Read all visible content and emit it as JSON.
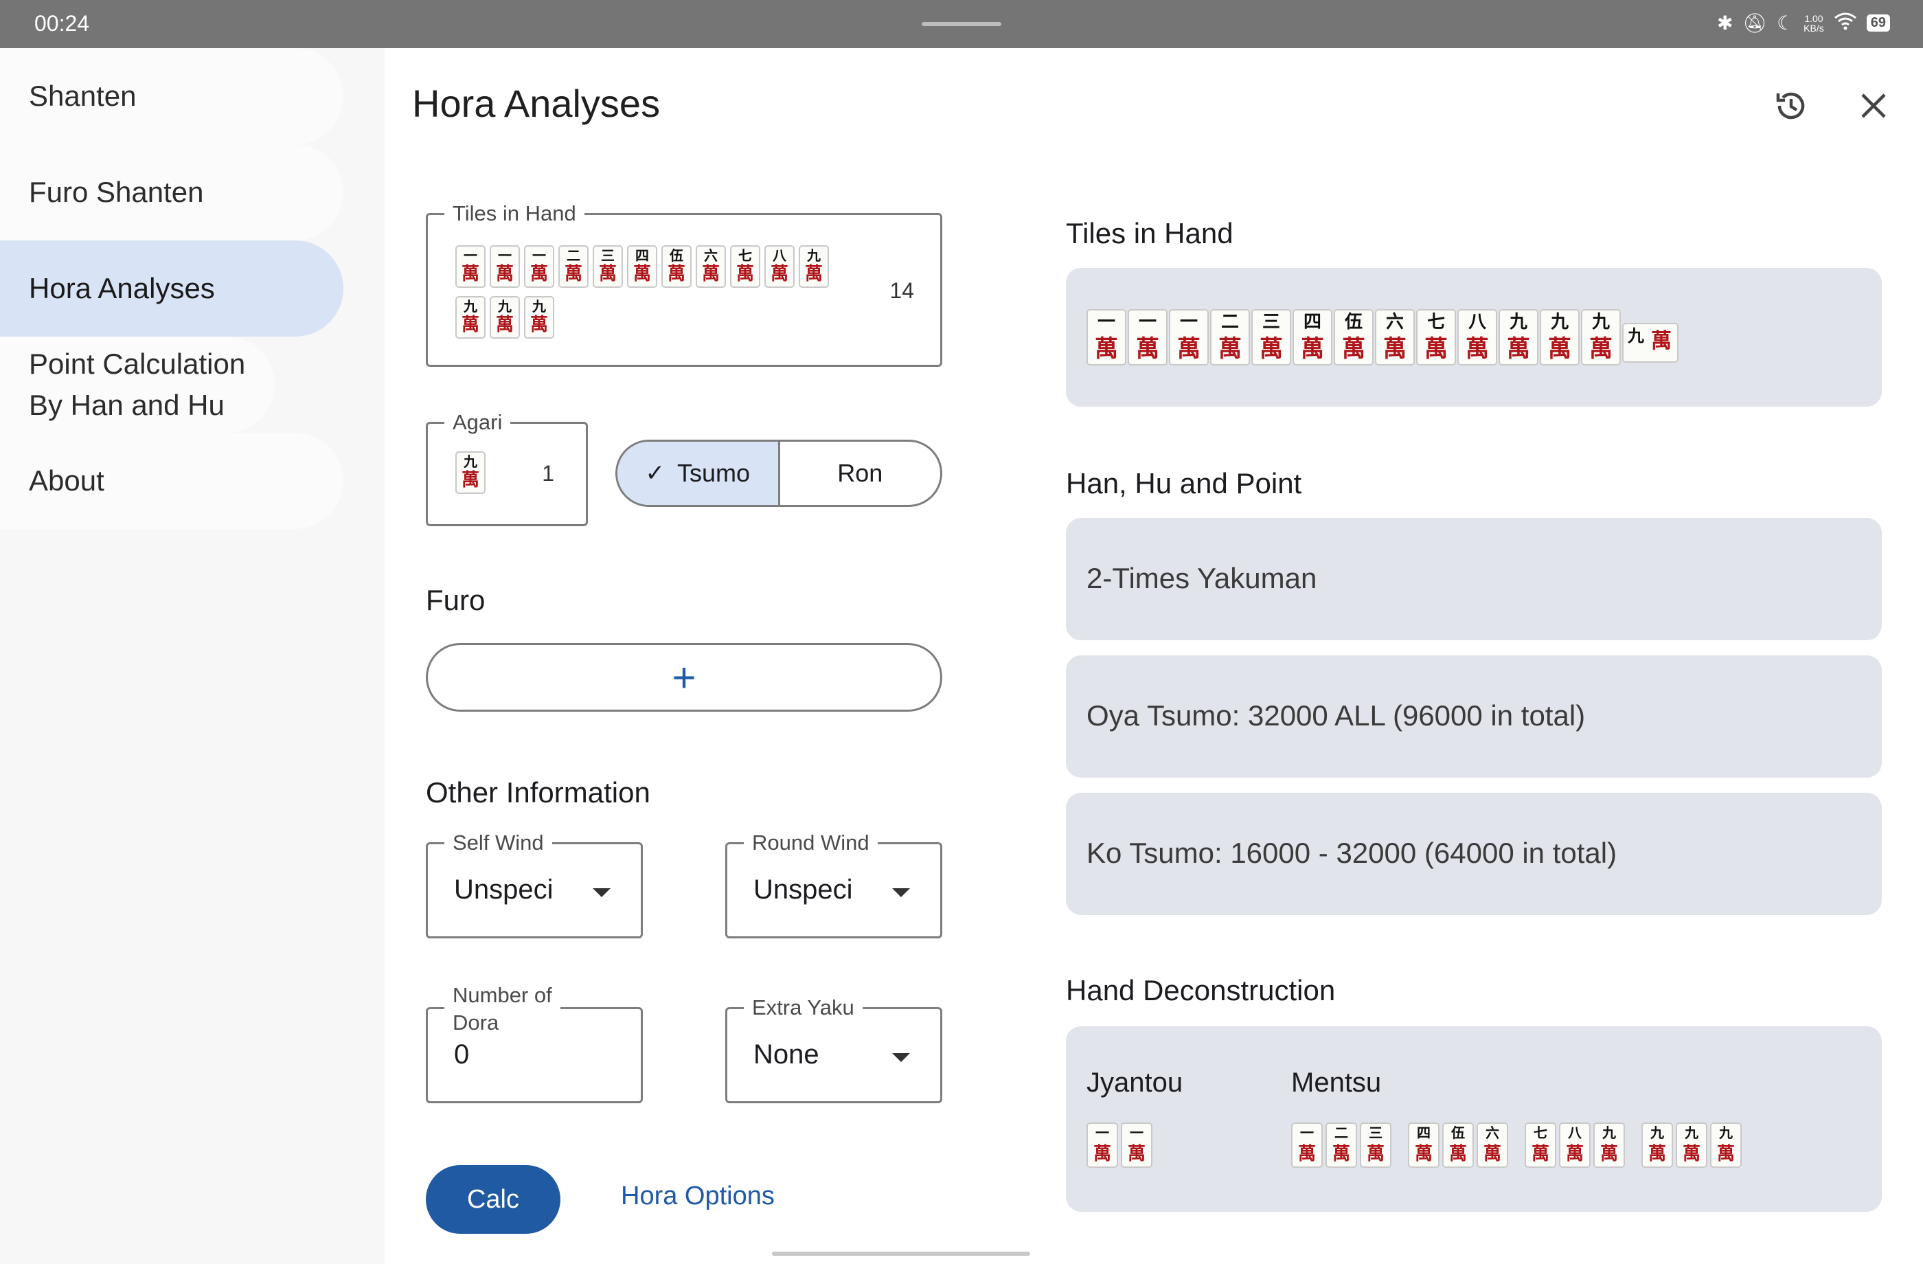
{
  "status_bar": {
    "time": "00:24",
    "speed_value": "1.00",
    "speed_unit": "KB/s",
    "battery": "69"
  },
  "sidebar": {
    "items": [
      {
        "label": "Shanten"
      },
      {
        "label": "Furo Shanten"
      },
      {
        "label": "Hora Analyses",
        "active": true
      },
      {
        "label": "Point Calculation By Han and Hu"
      },
      {
        "label": "About"
      }
    ]
  },
  "header": {
    "title": "Hora Analyses",
    "icons": [
      "history-icon",
      "close-icon"
    ]
  },
  "form": {
    "tiles_in_hand": {
      "label": "Tiles in Hand",
      "count": "14",
      "tiles": [
        "1m",
        "1m",
        "1m",
        "2m",
        "3m",
        "4m",
        "5m",
        "6m",
        "7m",
        "8m",
        "9m",
        "9m",
        "9m",
        "9m"
      ]
    },
    "agari": {
      "label": "Agari",
      "tile": "9m",
      "count": "1"
    },
    "agari_type": {
      "options": [
        "Tsumo",
        "Ron"
      ],
      "selected": "Tsumo"
    },
    "furo": {
      "title": "Furo",
      "add_label": "+"
    },
    "other_info": {
      "title": "Other Information",
      "self_wind": {
        "label": "Self Wind",
        "value": "Unspeci"
      },
      "round_wind": {
        "label": "Round Wind",
        "value": "Unspeci"
      },
      "dora": {
        "label_line1": "Number of",
        "label_line2": "Dora",
        "value": "0"
      },
      "extra_yaku": {
        "label": "Extra Yaku",
        "value": "None"
      }
    },
    "calc_label": "Calc",
    "options_label": "Hora Options"
  },
  "result": {
    "tiles_title": "Tiles in Hand",
    "tiles": [
      "1m",
      "1m",
      "1m",
      "2m",
      "3m",
      "4m",
      "5m",
      "6m",
      "7m",
      "8m",
      "9m",
      "9m",
      "9m"
    ],
    "agari_tile": "9m",
    "points_title": "Han, Hu and Point",
    "han_text": "2-Times Yakuman",
    "oya_text": "Oya Tsumo: 32000 ALL (96000 in total)",
    "ko_text": "Ko Tsumo: 16000 - 32000 (64000 in total)",
    "deconstruction_title": "Hand Deconstruction",
    "jyantou_label": "Jyantou",
    "mentsu_label": "Mentsu",
    "jyantou": [
      "1m",
      "1m"
    ],
    "mentsu": [
      [
        "1m",
        "2m",
        "3m"
      ],
      [
        "4m",
        "5m",
        "6m"
      ],
      [
        "7m",
        "8m",
        "9m"
      ],
      [
        "9m",
        "9m",
        "9m"
      ]
    ]
  },
  "tile_glyphs": {
    "1m": "一",
    "2m": "二",
    "3m": "三",
    "4m": "四",
    "5m": "伍",
    "6m": "六",
    "7m": "七",
    "8m": "八",
    "9m": "九",
    "suit": "萬"
  },
  "colors": {
    "accent": "#1f5aa3",
    "selected_bg": "#d8e3f5",
    "card_bg": "#e2e4ec",
    "tile_red": "#b0151a"
  }
}
